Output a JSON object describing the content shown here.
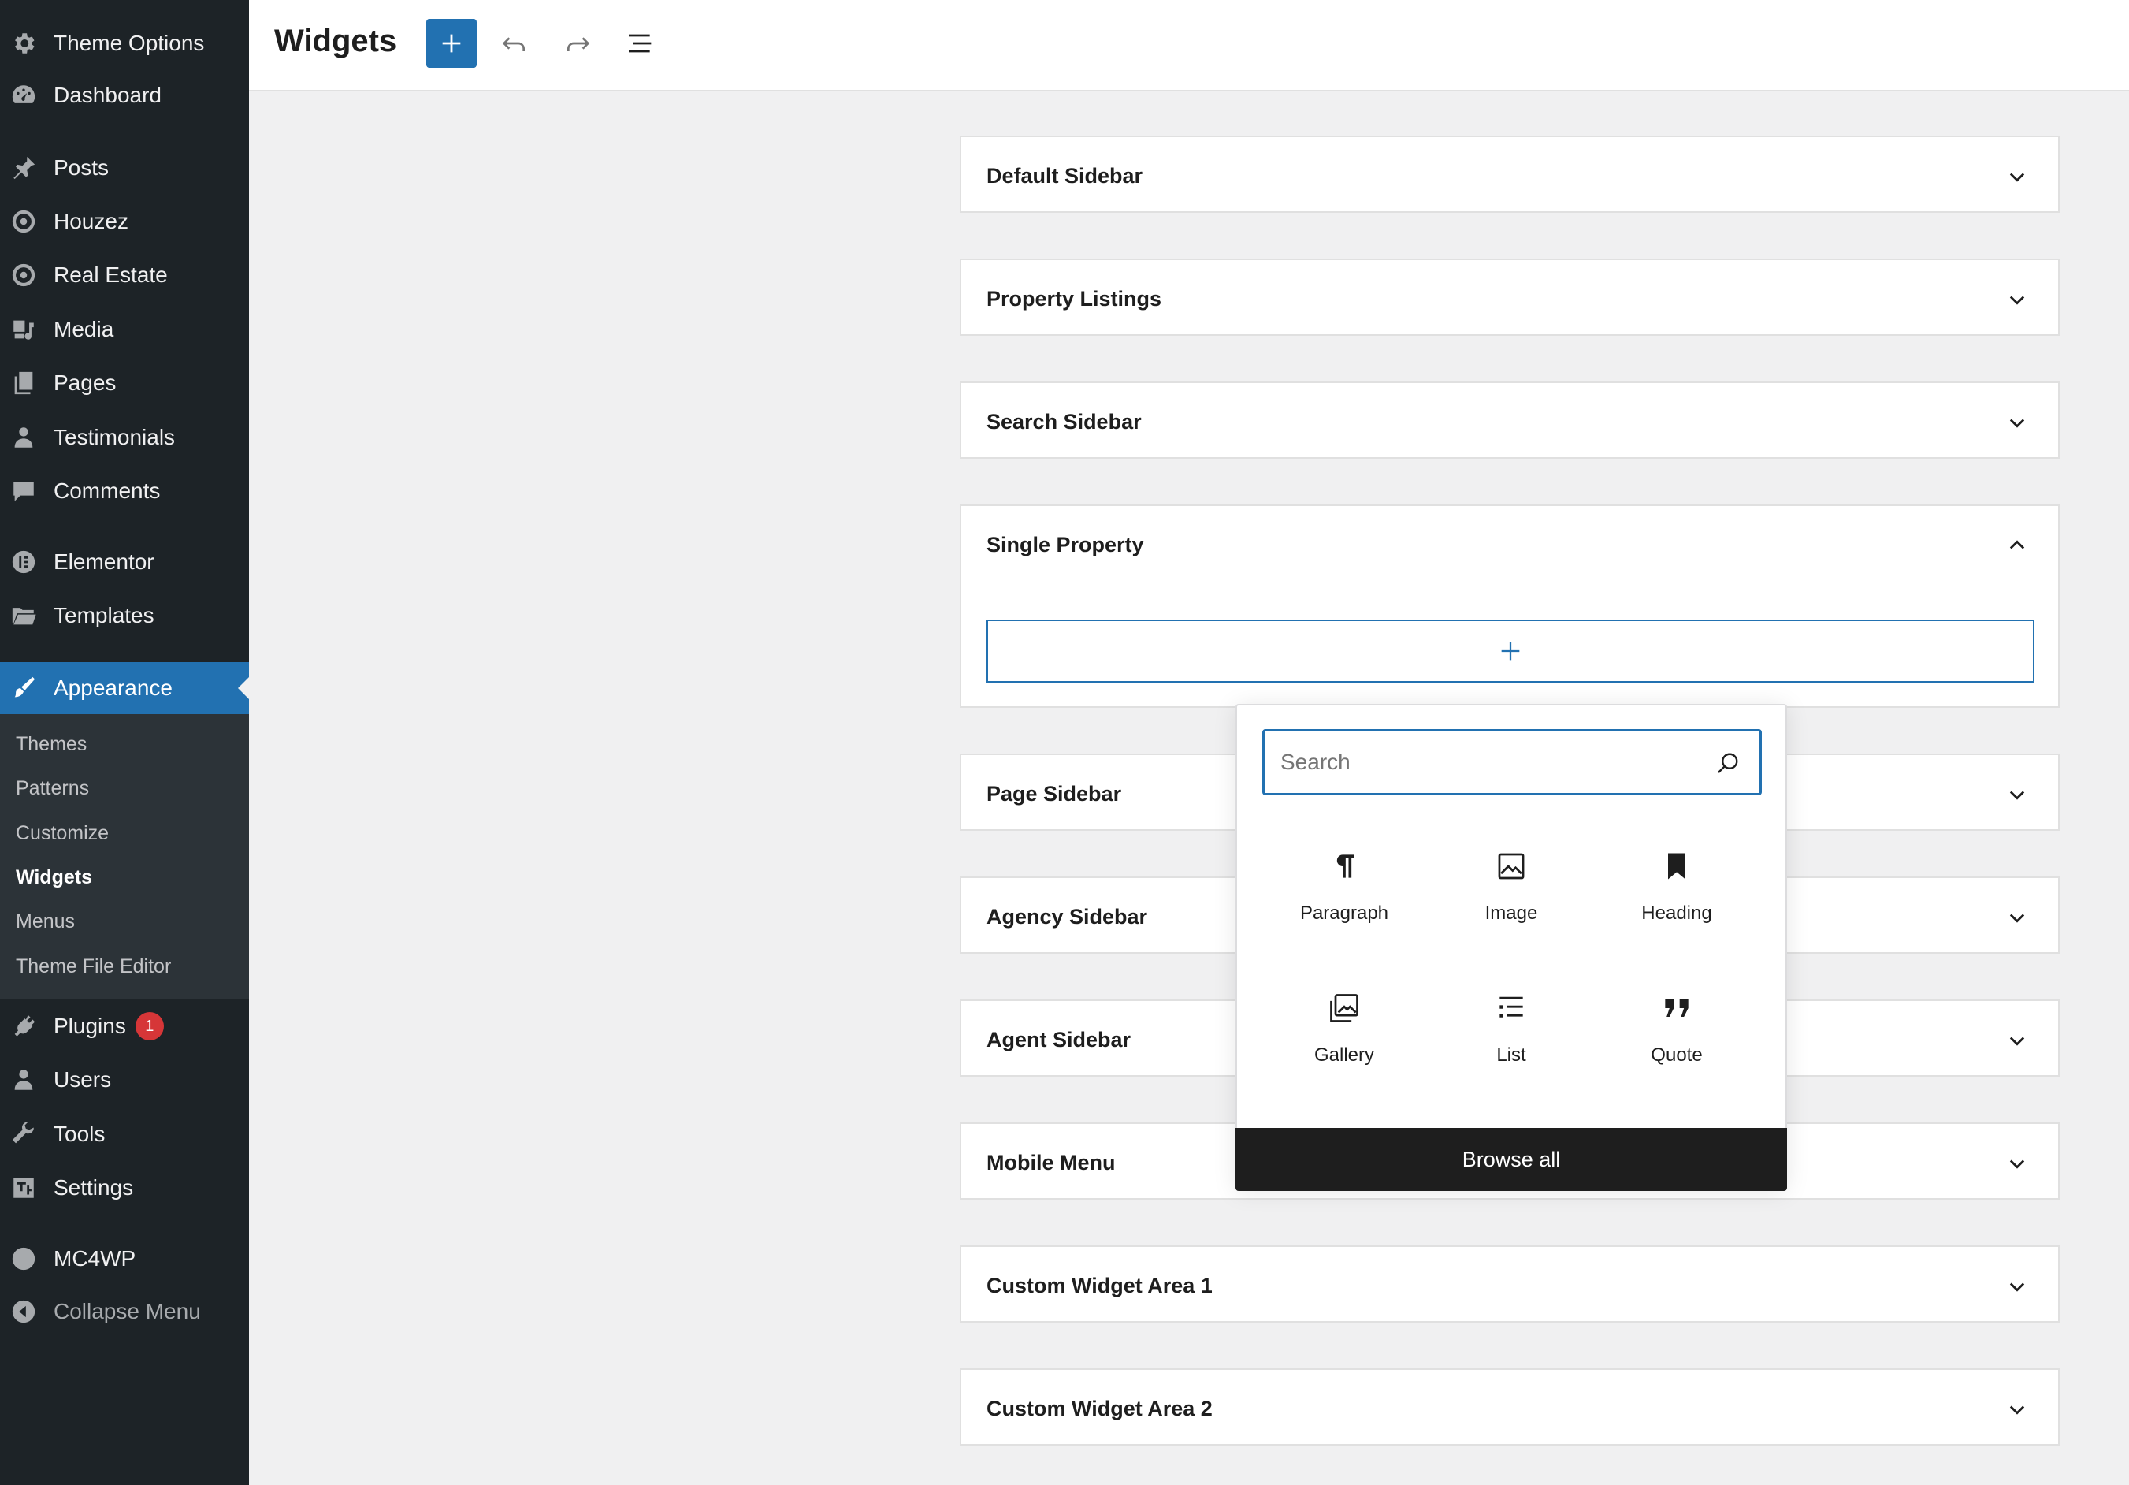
{
  "sidebar": {
    "items": [
      {
        "label": "Theme Options",
        "icon": "gear-icon"
      },
      {
        "label": "Dashboard",
        "icon": "dashboard-icon"
      },
      {
        "label": "Posts",
        "icon": "pin-icon"
      },
      {
        "label": "Houzez",
        "icon": "location-icon"
      },
      {
        "label": "Real Estate",
        "icon": "location-icon"
      },
      {
        "label": "Media",
        "icon": "media-icon"
      },
      {
        "label": "Pages",
        "icon": "pages-icon"
      },
      {
        "label": "Testimonials",
        "icon": "person-icon"
      },
      {
        "label": "Comments",
        "icon": "comment-icon"
      },
      {
        "label": "Elementor",
        "icon": "elementor-icon"
      },
      {
        "label": "Templates",
        "icon": "folder-icon"
      },
      {
        "label": "Appearance",
        "icon": "brush-icon"
      },
      {
        "label": "Plugins",
        "icon": "plug-icon",
        "badge": "1"
      },
      {
        "label": "Users",
        "icon": "user-icon"
      },
      {
        "label": "Tools",
        "icon": "wrench-icon"
      },
      {
        "label": "Settings",
        "icon": "settings-icon"
      },
      {
        "label": "MC4WP",
        "icon": "mc4wp-icon"
      },
      {
        "label": "Collapse Menu",
        "icon": "collapse-icon"
      }
    ],
    "submenu": [
      "Themes",
      "Patterns",
      "Customize",
      "Widgets",
      "Menus",
      "Theme File Editor"
    ],
    "active_color": "#2271b1"
  },
  "header": {
    "title": "Widgets",
    "add_block_icon": "plus-icon",
    "undo_icon": "undo-icon",
    "redo_icon": "redo-icon",
    "list_view_icon": "list-view-icon"
  },
  "widget_areas": [
    {
      "title": "Default Sidebar",
      "expanded": false
    },
    {
      "title": "Property Listings",
      "expanded": false
    },
    {
      "title": "Search Sidebar",
      "expanded": false
    },
    {
      "title": "Single Property",
      "expanded": true
    },
    {
      "title": "Page Sidebar",
      "expanded": false
    },
    {
      "title": "Agency Sidebar",
      "expanded": false
    },
    {
      "title": "Agent Sidebar",
      "expanded": false
    },
    {
      "title": "Mobile Menu",
      "expanded": false
    },
    {
      "title": "Custom Widget Area 1",
      "expanded": false
    },
    {
      "title": "Custom Widget Area 2",
      "expanded": false
    }
  ],
  "inserter": {
    "search_placeholder": "Search",
    "blocks": [
      {
        "label": "Paragraph",
        "icon": "paragraph-icon"
      },
      {
        "label": "Image",
        "icon": "image-icon"
      },
      {
        "label": "Heading",
        "icon": "heading-icon"
      },
      {
        "label": "Gallery",
        "icon": "gallery-icon"
      },
      {
        "label": "List",
        "icon": "list-icon"
      },
      {
        "label": "Quote",
        "icon": "quote-icon"
      }
    ],
    "browse_all": "Browse all"
  }
}
